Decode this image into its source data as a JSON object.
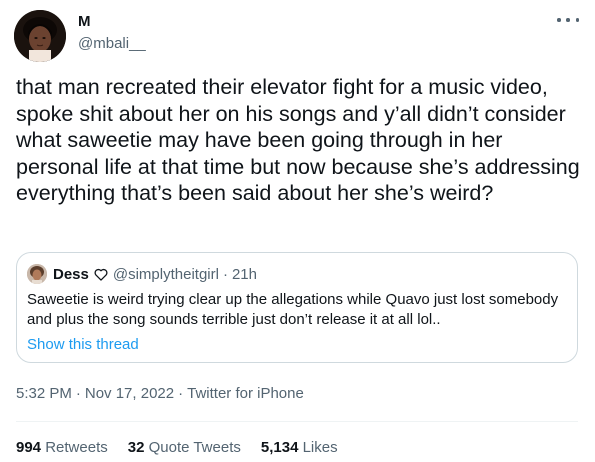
{
  "author": {
    "display_name": "M",
    "handle": "@mbali__"
  },
  "tweet": {
    "text": "that man recreated their elevator fight for a music video, spoke shit about her on his songs and y’all didn’t consider what saweetie may have been going through in her personal life at that time but now because she’s addressing everything that’s been said about her she’s weird?"
  },
  "quoted_tweet": {
    "display_name": "Dess",
    "badge_icon": "heart-outline-icon",
    "handle": "@simplytheitgirl",
    "separator": "·",
    "time": "21h",
    "text": "Saweetie is weird trying clear up the allegations while Quavo just lost somebody and plus the song sounds terrible just don’t release it at all lol..",
    "show_thread": "Show this thread"
  },
  "meta": {
    "time": "5:32 PM",
    "separator": "·",
    "date": "Nov 17, 2022",
    "source": "Twitter for iPhone"
  },
  "stats": {
    "retweets_count": "994",
    "retweets_label": "Retweets",
    "quote_count": "32",
    "quote_label": "Quote Tweets",
    "likes_count": "5,134",
    "likes_label": "Likes"
  },
  "colors": {
    "text_primary": "#0f1419",
    "text_secondary": "#536471",
    "link": "#1d9bf0",
    "border": "#cfd9de"
  }
}
